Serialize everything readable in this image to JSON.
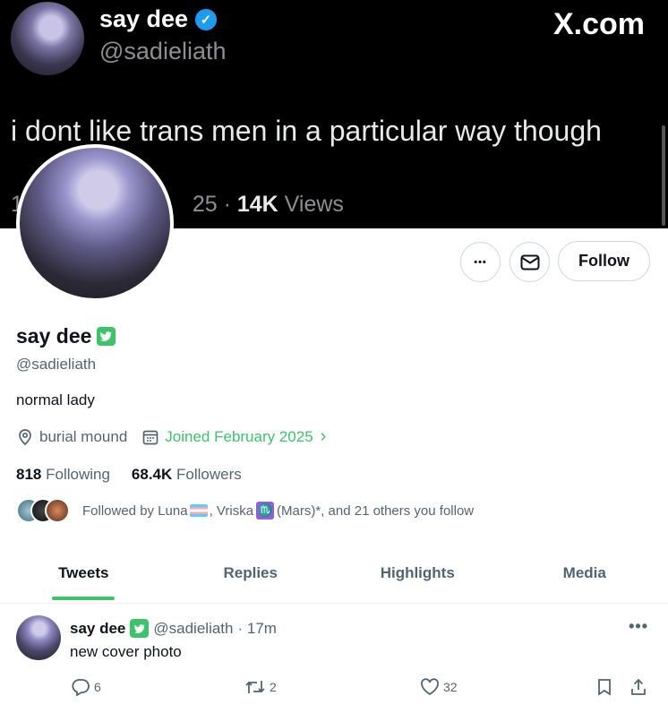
{
  "cover": {
    "name": "say dee",
    "handle": "@sadieliath",
    "logo": "X.com",
    "text": "i dont like trans men in a particular way though",
    "meta_left": "1",
    "meta_date": "25 · ",
    "views": "14K",
    "views_label": " Views"
  },
  "actions": {
    "more": "•••",
    "message_icon": "envelope-icon",
    "follow": "Follow"
  },
  "profile": {
    "name": "say dee",
    "handle": "@sadieliath",
    "bio": "normal lady",
    "location": "burial mound",
    "joined": "Joined February 2025",
    "following_count": "818",
    "following_label": "Following",
    "followers_count": "68.4K",
    "followers_label": "Followers",
    "followed_by_prefix": "Followed by Luna",
    "followed_by_mid": ", Vriska",
    "followed_by_sign": "♏",
    "followed_by_suffix": " (Mars)*, and 21 others you follow"
  },
  "tabs": [
    {
      "label": "Tweets",
      "active": true
    },
    {
      "label": "Replies"
    },
    {
      "label": "Highlights"
    },
    {
      "label": "Media"
    }
  ],
  "tweet": {
    "name": "say dee",
    "handle": "@sadieliath",
    "time": "· 17m",
    "text": "new cover photo",
    "more": "•••",
    "replies": "6",
    "retweets": "2",
    "likes": "32"
  },
  "colors": {
    "accent": "#3bc46a",
    "verified_blue": "#1d9bf0",
    "muted": "#536471"
  }
}
